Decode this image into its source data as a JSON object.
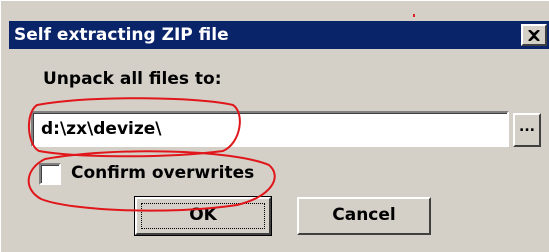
{
  "window": {
    "title": "Self extracting ZIP file",
    "close_glyph": "X"
  },
  "form": {
    "unpack_label": "Unpack all files to:",
    "path_value": "d:\\zx\\devize\\",
    "browse_label": "...",
    "confirm_label": "Confirm overwrites",
    "confirm_checked": false
  },
  "buttons": {
    "ok_label": "OK",
    "cancel_label": "Cancel"
  },
  "colors": {
    "titlebar": "#0a246a",
    "face": "#d4d0c8",
    "annotation": "#e0161b"
  }
}
